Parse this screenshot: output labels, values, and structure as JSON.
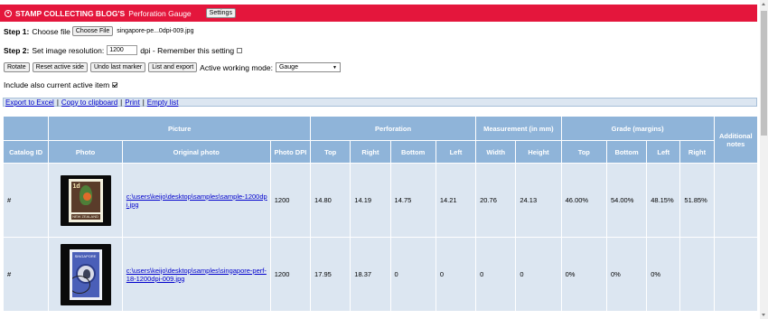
{
  "header": {
    "brand": "STAMP COLLECTING BLOG'S",
    "subtitle": "Perforation Gauge",
    "settings_label": "Settings"
  },
  "step1": {
    "label": "Step 1:",
    "text": "Choose file",
    "choose_file_label": "Choose File",
    "filename": "singapore-pe...0dpi-009.jpg"
  },
  "step2": {
    "label": "Step 2:",
    "text": "Set image resolution:",
    "resolution_value": "1200",
    "unit": "dpi - Remember this setting",
    "remember_checked": false
  },
  "toolbar": {
    "rotate_label": "Rotate",
    "reset_label": "Reset active side",
    "undo_label": "Undo last marker",
    "list_export_label": "List and export",
    "mode_label": "Active working mode:",
    "mode_value": "Gauge"
  },
  "include_active": {
    "label": "Include also current active item",
    "checked": true
  },
  "links": {
    "export_excel": "Export to Excel",
    "copy_clipboard": "Copy to clipboard",
    "print": "Print",
    "empty_list": "Empty list",
    "separator": "|"
  },
  "table": {
    "group_headers": {
      "picture": "Picture",
      "perforation": "Perforation",
      "measurement": "Measurement (in mm)",
      "grade": "Grade (margins)"
    },
    "columns": {
      "catalog_id": "Catalog ID",
      "photo": "Photo",
      "original_photo": "Original photo",
      "photo_dpi": "Photo DPI",
      "perf_top": "Top",
      "perf_right": "Right",
      "perf_bottom": "Bottom",
      "perf_left": "Left",
      "width": "Width",
      "height": "Height",
      "grade_top": "Top",
      "grade_bottom": "Bottom",
      "grade_left": "Left",
      "grade_right": "Right",
      "notes": "Additional notes"
    },
    "rows": [
      {
        "catalog_id": "#",
        "original_photo": "c:\\users\\keijo\\desktop\\samples\\sample-1200dpi.jpg",
        "photo_dpi": "1200",
        "perf_top": "14.80",
        "perf_right": "14.19",
        "perf_bottom": "14.75",
        "perf_left": "14.21",
        "width": "20.76",
        "height": "24.13",
        "grade_top": "46.00%",
        "grade_bottom": "54.00%",
        "grade_left": "48.15%",
        "grade_right": "51.85%",
        "notes": "",
        "stamp": {
          "value": "1d",
          "country": "NEW ZEALAND",
          "colors": [
            "#5a3c2a",
            "#4e7e38",
            "#e06b2a"
          ]
        }
      },
      {
        "catalog_id": "#",
        "original_photo": "c:\\users\\keijo\\desktop\\samples\\singapore-perf-18-1200dpi-009.jpg",
        "photo_dpi": "1200",
        "perf_top": "17.95",
        "perf_right": "18.37",
        "perf_bottom": "0",
        "perf_left": "0",
        "width": "0",
        "height": "0",
        "grade_top": "0%",
        "grade_bottom": "0%",
        "grade_left": "0%",
        "grade_right": "",
        "notes": "",
        "stamp": {
          "country": "SINGAPORE",
          "colors": [
            "#4a5fb8",
            "#d8dbe8"
          ]
        }
      }
    ]
  },
  "colors": {
    "header_bg": "#e4163c",
    "table_header_bg": "#8fb4d9",
    "table_cell_bg": "#dce6f1",
    "link": "#0000cc"
  }
}
